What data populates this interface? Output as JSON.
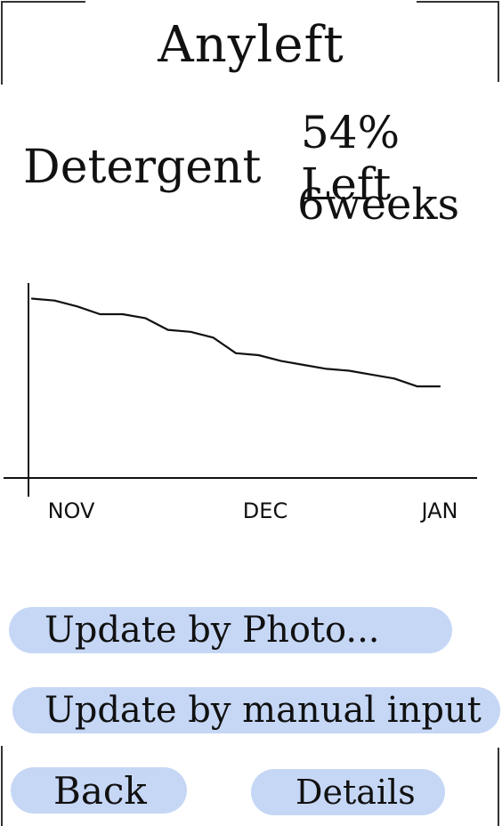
{
  "app": {
    "title": "Anyleft"
  },
  "item": {
    "name": "Detergent",
    "remaining_label": "54% Left",
    "remaining_percent": 54,
    "duration_label": "6weeks"
  },
  "chart_data": {
    "type": "line",
    "categories": [
      "NOV",
      "DEC",
      "JAN"
    ],
    "series": [
      {
        "values": [
          92,
          91,
          88,
          84,
          84,
          82,
          76,
          75,
          72,
          64,
          63,
          60,
          58,
          56,
          55,
          53,
          51,
          47,
          47
        ]
      }
    ],
    "ylim": [
      0,
      100
    ],
    "grid": false,
    "title": "",
    "xlabel": "",
    "ylabel": ""
  },
  "actions": {
    "update_photo": "Update by Photo...",
    "update_manual": "Update by manual input",
    "back": "Back",
    "details": "Details"
  },
  "colors": {
    "button_fill": "#c6d7f6",
    "ink": "#111111"
  }
}
